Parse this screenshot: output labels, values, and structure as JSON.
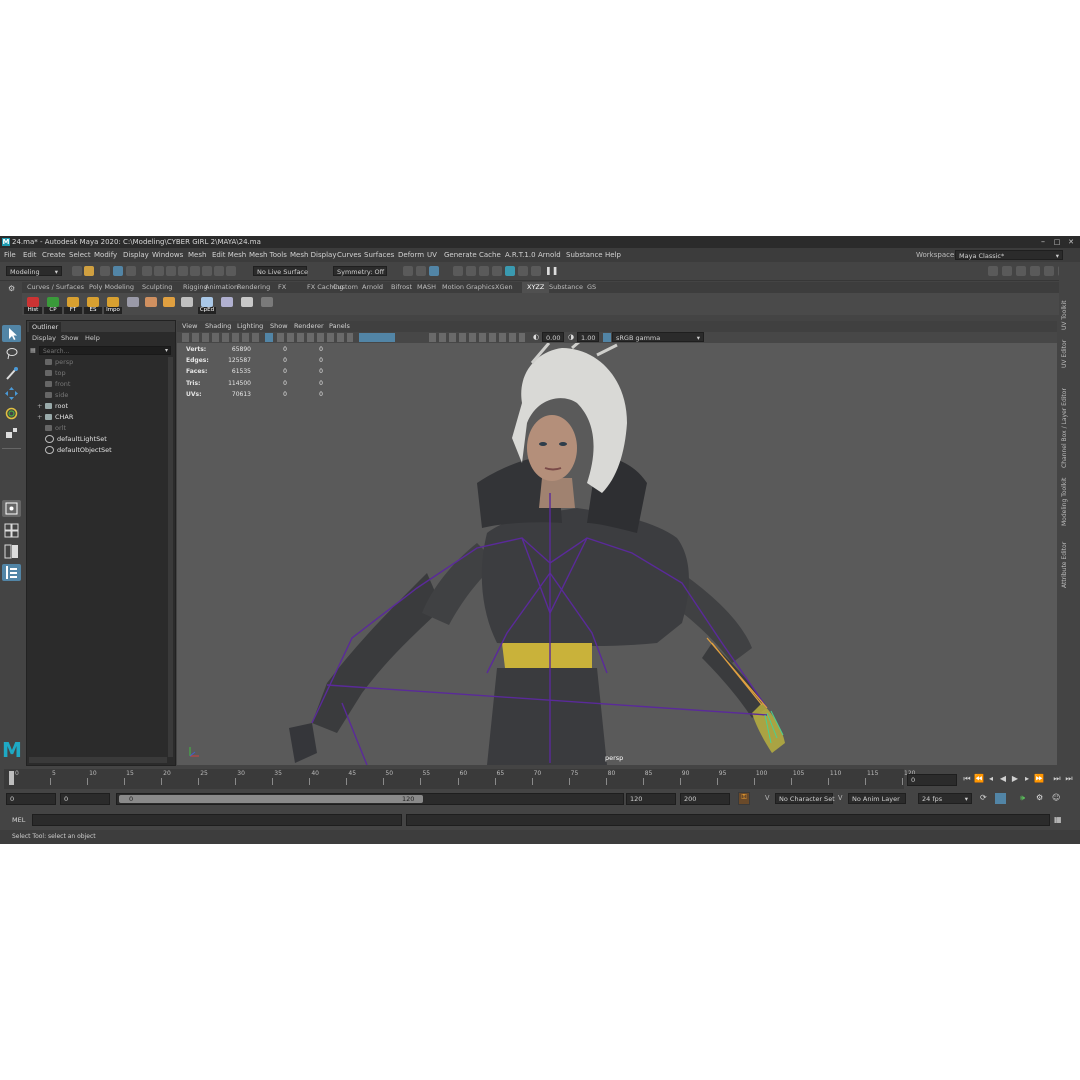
{
  "window": {
    "title": "24.ma* - Autodesk Maya 2020: C:\\Modeling\\CYBER GIRL 2\\MAYA\\24.ma",
    "logo_letter": "M",
    "buttons": {
      "minimize": "–",
      "maximize": "□",
      "close": "✕"
    }
  },
  "menubar": {
    "items": [
      "File",
      "Edit",
      "Create",
      "Select",
      "Modify",
      "Display",
      "Windows",
      "Mesh",
      "Edit Mesh",
      "Mesh Tools",
      "Mesh Display",
      "Curves",
      "Surfaces",
      "Deform",
      "UV",
      "Generate",
      "Cache",
      "A.R.T.1.0",
      "Arnold",
      "Substance",
      "Help"
    ],
    "workspace_label": "Workspace :",
    "workspace_value": "Maya Classic*"
  },
  "statusline": {
    "mode": "Modeling",
    "live_surface": "No Live Surface",
    "symmetry": "Symmetry: Off"
  },
  "shelf": {
    "tabs": [
      "Curves / Surfaces",
      "Poly Modeling",
      "Sculpting",
      "Rigging",
      "Animation",
      "Rendering",
      "FX",
      "FX Caching",
      "Custom",
      "Arnold",
      "Bifrost",
      "MASH",
      "Motion Graphics",
      "XGen",
      "XYZZ",
      "Substance",
      "GS"
    ],
    "active_tab": "XYZZ",
    "icons": [
      {
        "label": "Hist",
        "color": "#cc3333"
      },
      {
        "label": "CP",
        "color": "#3a9a3a"
      },
      {
        "label": "FT",
        "color": "#d8a030"
      },
      {
        "label": "ES",
        "color": "#d8a030"
      },
      {
        "label": "Impo",
        "color": "#d8a030"
      },
      {
        "label": "",
        "color": "#9a9aa8"
      },
      {
        "label": "",
        "color": "#d09060"
      },
      {
        "label": "",
        "color": "#e0a040"
      },
      {
        "label": "",
        "color": "#c0c0c0"
      },
      {
        "label": "CpEd",
        "color": "#aac8e8"
      },
      {
        "label": "",
        "color": "#b0b0d0"
      },
      {
        "label": "",
        "color": "#c8c8c8"
      },
      {
        "label": "",
        "color": "#7a7a7a"
      }
    ]
  },
  "outliner": {
    "tab": "Outliner",
    "menus": [
      "Display",
      "Show",
      "Help"
    ],
    "search_placeholder": "Search...",
    "items": [
      {
        "label": "persp",
        "dim": true,
        "expand": ""
      },
      {
        "label": "top",
        "dim": true,
        "expand": ""
      },
      {
        "label": "front",
        "dim": true,
        "expand": ""
      },
      {
        "label": "side",
        "dim": true,
        "expand": ""
      },
      {
        "label": "root",
        "dim": false,
        "expand": "+"
      },
      {
        "label": "CHAR",
        "dim": false,
        "expand": "+"
      },
      {
        "label": "orlt",
        "dim": true,
        "expand": ""
      },
      {
        "label": "defaultLightSet",
        "dim": false,
        "expand": ""
      },
      {
        "label": "defaultObjectSet",
        "dim": false,
        "expand": ""
      }
    ]
  },
  "viewport": {
    "menus": [
      "View",
      "Shading",
      "Lighting",
      "Show",
      "Renderer",
      "Panels"
    ],
    "exposure": "0.00",
    "gamma": "1.00",
    "color_space": "sRGB gamma",
    "camera_label": "persp",
    "hud": [
      {
        "label": "Verts:",
        "values": [
          "65890",
          "0",
          "0"
        ]
      },
      {
        "label": "Edges:",
        "values": [
          "125587",
          "0",
          "0"
        ]
      },
      {
        "label": "Faces:",
        "values": [
          "61535",
          "0",
          "0"
        ]
      },
      {
        "label": "Tris:",
        "values": [
          "114500",
          "0",
          "0"
        ]
      },
      {
        "label": "UVs:",
        "values": [
          "70613",
          "0",
          "0"
        ]
      }
    ]
  },
  "right_tabs": [
    "UV Toolkit",
    "UV Editor",
    "Channel Box / Layer Editor",
    "Modeling Toolkit",
    "Attribute Editor"
  ],
  "timeline": {
    "ticks": [
      "0",
      "5",
      "10",
      "15",
      "20",
      "25",
      "30",
      "35",
      "40",
      "45",
      "50",
      "55",
      "60",
      "65",
      "70",
      "75",
      "80",
      "85",
      "90",
      "95",
      "100",
      "105",
      "110",
      "115",
      "120"
    ],
    "current_frame": "0"
  },
  "range": {
    "start": "0",
    "playback_start": "0",
    "slider_start": "0",
    "slider_end": "120",
    "playback_end": "120",
    "end": "200",
    "character_set": "No Character Set",
    "anim_layer": "No Anim Layer",
    "fps": "24 fps"
  },
  "cmdline": {
    "label": "MEL"
  },
  "helpline": {
    "text": "Select Tool: select an object"
  }
}
